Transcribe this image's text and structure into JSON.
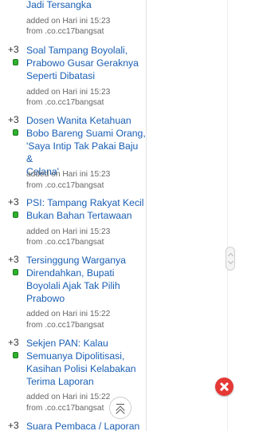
{
  "feed": {
    "items": [
      {
        "score": "",
        "title_lines": [
          "Jadi Tersangka"
        ],
        "added": "added on Hari ini 15:23",
        "source": "from .co.cc17bangsat"
      },
      {
        "score": "+3",
        "title_lines": [
          "Soal Tampang Boyolali,",
          "Prabowo Gusar Geraknya",
          "Seperti Dibatasi"
        ],
        "added": "added on Hari ini 15:23",
        "source": "from .co.cc17bangsat"
      },
      {
        "score": "+3",
        "title_lines": [
          "Dosen Wanita Ketahuan",
          "Bobo Bareng Suami Orang,",
          "'Saya Intip Tak Pakai Baju &",
          "Celana'"
        ],
        "added": "added on Hari ini 15:23",
        "source": "from .co.cc17bangsat"
      },
      {
        "score": "+3",
        "title_lines": [
          "PSI: Tampang Rakyat Kecil",
          "Bukan Bahan Tertawaan"
        ],
        "added": "added on Hari ini 15:23",
        "source": "from .co.cc17bangsat"
      },
      {
        "score": "+3",
        "title_lines": [
          "Tersinggung Warganya",
          "Direndahkan, Bupati",
          "Boyolali Ajak Tak Pilih",
          "Prabowo"
        ],
        "added": "added on Hari ini 15:22",
        "source": "from .co.cc17bangsat"
      },
      {
        "score": "+3",
        "title_lines": [
          "Sekjen PAN: Kalau",
          "Semuanya Dipolitisasi,",
          "Kasihan Polisi Kelabakan",
          "Terima Laporan"
        ],
        "added": "added on Hari ini 15:22",
        "source": "from .co.cc17bangsat"
      },
      {
        "score": "+3",
        "title_lines": [
          "Suara Pembaca / Laporan"
        ],
        "added": "",
        "source": ""
      }
    ]
  },
  "controls": {
    "close_icon": "close-icon",
    "scroll_to_top_icon": "double-chevron-up-icon",
    "scroll_handle_icon": "scroll-handle-icon"
  },
  "colors": {
    "link": "#1a5fb4",
    "vote_badge": "#2fb12f",
    "close": "#e53935"
  }
}
